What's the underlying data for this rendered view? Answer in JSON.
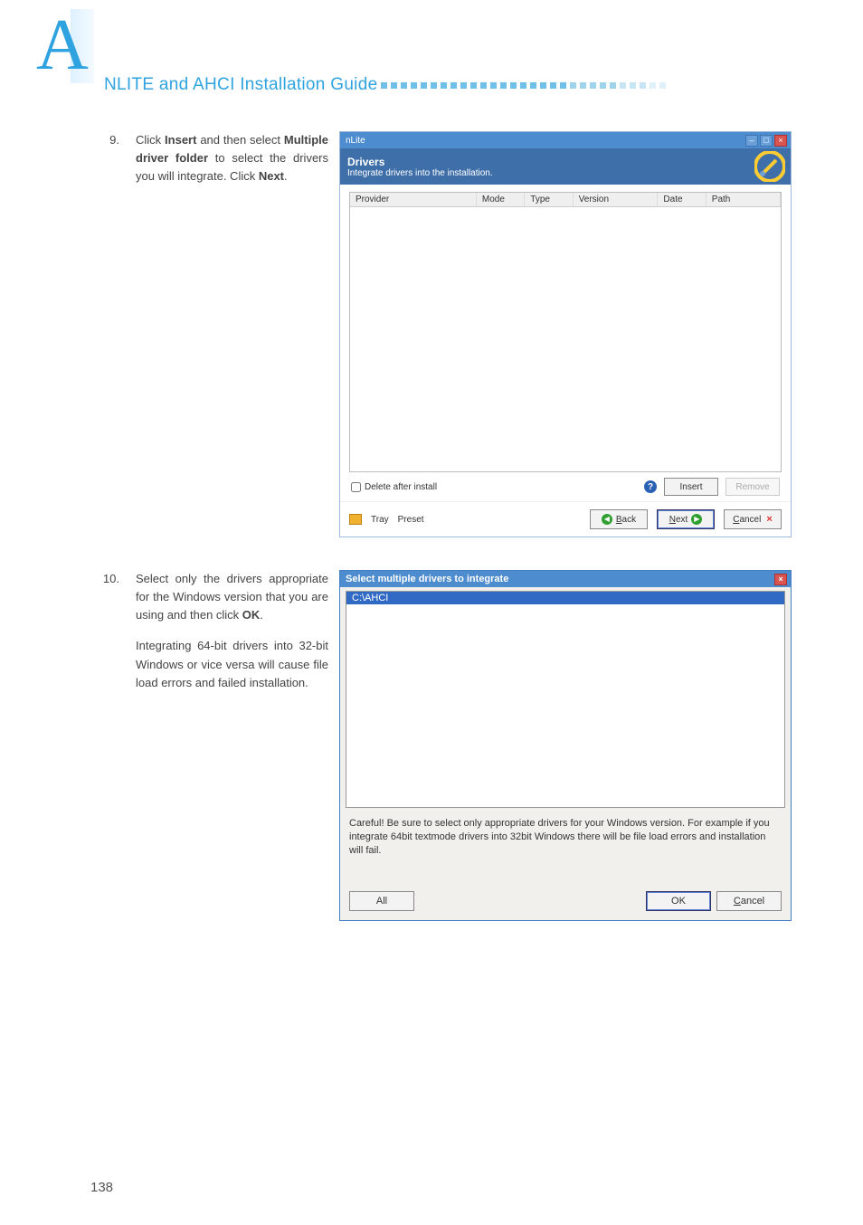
{
  "header": {
    "badge_letter": "A",
    "title": "NLITE and AHCI Installation Guide"
  },
  "step9": {
    "number": "9.",
    "text_parts": {
      "p1": "Click ",
      "b1": "Insert",
      "p2": " and then select ",
      "b2": "Multiple driver folder",
      "p3": " to select the drivers you will integrate. Click ",
      "b3": "Next",
      "p4": "."
    }
  },
  "nlite": {
    "title": "nLite",
    "header_title": "Drivers",
    "header_sub": "Integrate drivers into the installation.",
    "columns": {
      "provider": "Provider",
      "mode": "Mode",
      "type": "Type",
      "version": "Version",
      "date": "Date",
      "path": "Path"
    },
    "delete_after_install": "Delete after install",
    "help_icon": "?",
    "insert_btn": "Insert",
    "remove_btn": "Remove",
    "tray": "Tray",
    "preset": "Preset",
    "back_char": "B",
    "back_rest": "ack",
    "next_char": "N",
    "next_rest": "ext",
    "cancel_char": "C",
    "cancel_rest": "ancel"
  },
  "step10": {
    "number": "10.",
    "text_parts": {
      "p1": "Select only the drivers appropriate for the Windows version that you are using and then click ",
      "b1": "OK",
      "p2": "."
    },
    "text2": "Integrating 64-bit drivers into 32-bit Windows or vice versa will cause file load errors and failed installation."
  },
  "sel": {
    "title": "Select multiple drivers to integrate",
    "list_item": "C:\\AHCI",
    "warning": "Careful! Be sure to select only appropriate drivers for your Windows version. For example if you integrate 64bit textmode drivers into 32bit Windows there will be file load errors and installation will fail.",
    "all_btn": "All",
    "ok_btn": "OK",
    "cancel_char": "C",
    "cancel_rest": "ancel"
  },
  "page_number": "138"
}
